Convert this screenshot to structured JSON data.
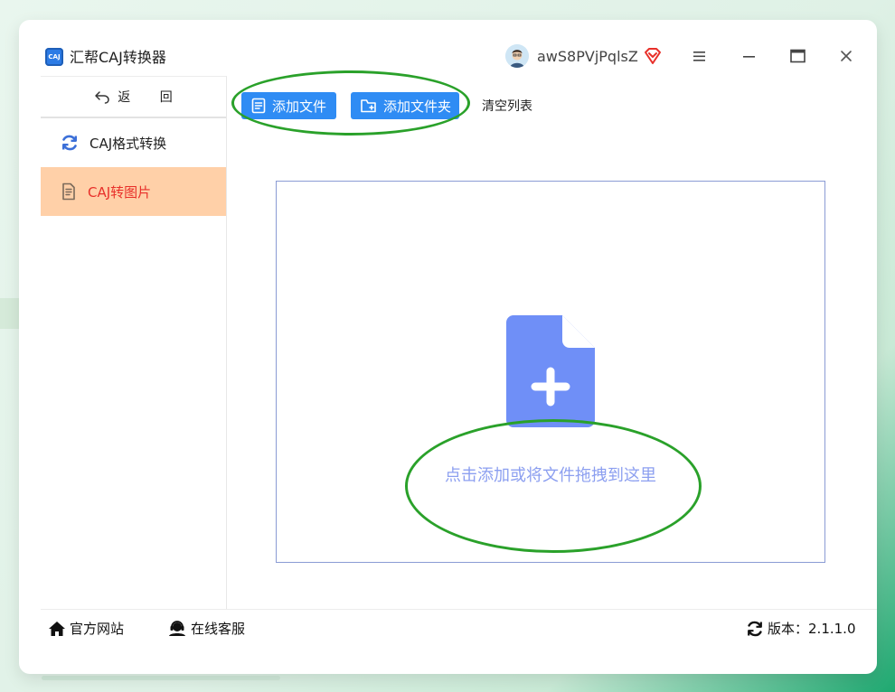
{
  "app": {
    "logo_text": "CAJ",
    "title": "汇帮CAJ转换器"
  },
  "user": {
    "name": "awS8PVjPqlsZ"
  },
  "sidebar": {
    "back_label": "返 回",
    "items": [
      {
        "label": "CAJ格式转换",
        "icon": "refresh-icon",
        "active": false
      },
      {
        "label": "CAJ转图片",
        "icon": "document-icon",
        "active": true
      }
    ]
  },
  "toolbar": {
    "add_file": "添加文件",
    "add_folder": "添加文件夹",
    "clear_list": "清空列表"
  },
  "dropzone": {
    "hint": "点击添加或将文件拖拽到这里"
  },
  "footer": {
    "website": "官方网站",
    "service": "在线客服",
    "version_label": "版本：",
    "version": "2.1.1.0"
  },
  "colors": {
    "primary": "#2f8cf4",
    "active_bg": "#ffd0a8",
    "active_text": "#e8302a",
    "drop_icon": "#6f8ff7",
    "drop_text": "#8c9ff0",
    "annotation": "#2aa12a"
  }
}
